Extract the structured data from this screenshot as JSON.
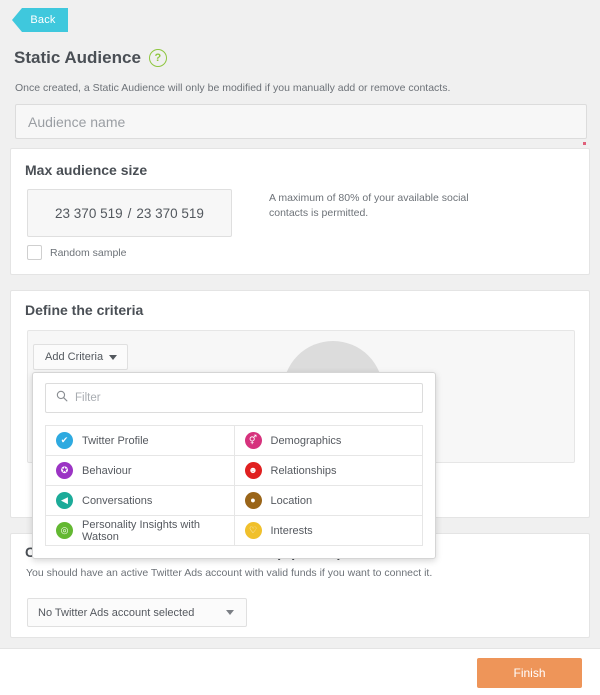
{
  "nav": {
    "back_label": "Back"
  },
  "header": {
    "title": "Static Audience",
    "help_icon": "question-mark-icon",
    "subtitle": "Once created, a Static Audience will only be modified if you manually add or remove contacts."
  },
  "audience_name": {
    "value": "",
    "placeholder": "Audience name"
  },
  "max_audience": {
    "title": "Max audience size",
    "current": "23 370 519",
    "separator": "/",
    "total": "23 370 519",
    "note": "A maximum of 80% of your available social contacts is permitted.",
    "random_sample_label": "Random sample",
    "random_sample_checked": false
  },
  "criteria": {
    "title": "Define the criteria",
    "add_button_label": "Add Criteria",
    "filter_placeholder": "Filter",
    "filter_value": "",
    "options": [
      {
        "label": "Twitter Profile",
        "icon": "twitter-bird-icon",
        "glyph": "✔",
        "color": "#2eaae0"
      },
      {
        "label": "Demographics",
        "icon": "gender-symbol-icon",
        "glyph": "⚥",
        "color": "#d6327d"
      },
      {
        "label": "Behaviour",
        "icon": "puzzle-piece-icon",
        "glyph": "✪",
        "color": "#9b34c4"
      },
      {
        "label": "Relationships",
        "icon": "people-group-icon",
        "glyph": "☻",
        "color": "#e02020"
      },
      {
        "label": "Conversations",
        "icon": "megaphone-icon",
        "glyph": "◀",
        "color": "#1cab99"
      },
      {
        "label": "Location",
        "icon": "map-pin-icon",
        "glyph": "●",
        "color": "#9a6519"
      },
      {
        "label": "Personality Insights with Watson",
        "icon": "watson-globe-icon",
        "glyph": "◎",
        "color": "#63b832"
      },
      {
        "label": "Interests",
        "icon": "heart-badge-icon",
        "glyph": "♡",
        "color": "#f0c02c"
      }
    ]
  },
  "connect": {
    "title": "Connect this Audience to Twitter Ads (Optional)",
    "subtitle": "You should have an active Twitter Ads account with valid funds if you want to connect it.",
    "select_value": "No Twitter Ads account selected"
  },
  "footer": {
    "finish_label": "Finish"
  },
  "colors": {
    "accent_cyan": "#3fc8dd",
    "accent_orange": "#ee9559",
    "help_green": "#8ec63f",
    "page_bg": "#f0f0f0",
    "card_bg": "#ffffff"
  }
}
